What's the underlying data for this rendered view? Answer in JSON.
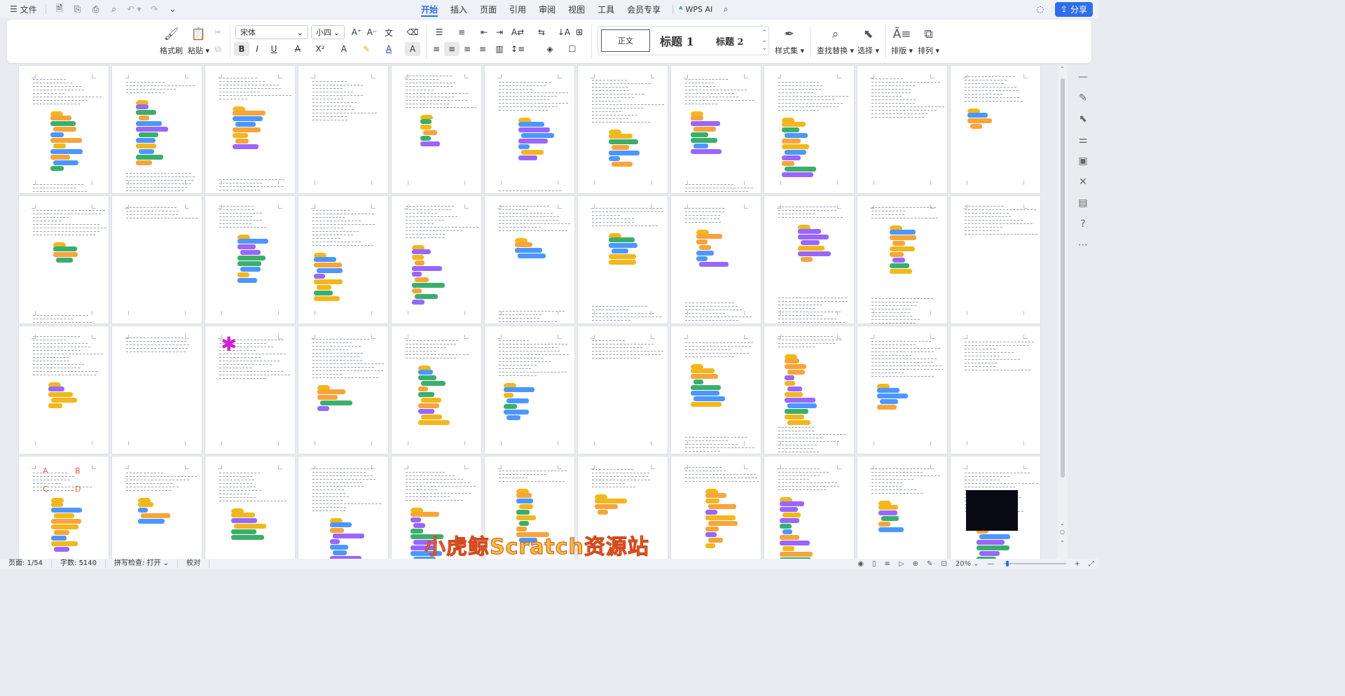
{
  "titlebar": {
    "file_menu": "文件",
    "tabs": [
      "开始",
      "插入",
      "页面",
      "引用",
      "审阅",
      "视图",
      "工具",
      "会员专享"
    ],
    "active_tab": "开始",
    "wps_ai": "WPS AI",
    "share": "分享"
  },
  "ribbon": {
    "format_painter": "格式刷",
    "paste": "粘贴",
    "font_name": "宋体",
    "font_size": "小四",
    "style_normal": "正文",
    "style_h1": "标题 1",
    "style_h2": "标题 2",
    "style_set": "样式集",
    "find_replace": "查找替换",
    "select": "选择",
    "layout": "排版",
    "arrange": "排列"
  },
  "statusbar": {
    "page": "页面: 1/54",
    "words": "字数: 5140",
    "spell": "拼写检查: 打开",
    "proof": "校对",
    "zoom": "20%"
  },
  "watermark": "小虎鲸Scratch资源站",
  "thumb_letters": [
    "A",
    "B",
    "C",
    "D"
  ],
  "colors": {
    "accent": "#2f6ee8",
    "scratch_orange": "#f7a43a",
    "scratch_yellow": "#f2b71c",
    "scratch_green": "#3bae6c",
    "scratch_blue": "#4c97ff",
    "scratch_purple": "#9966ff",
    "magenta_asterisk": "#d21fd2"
  }
}
